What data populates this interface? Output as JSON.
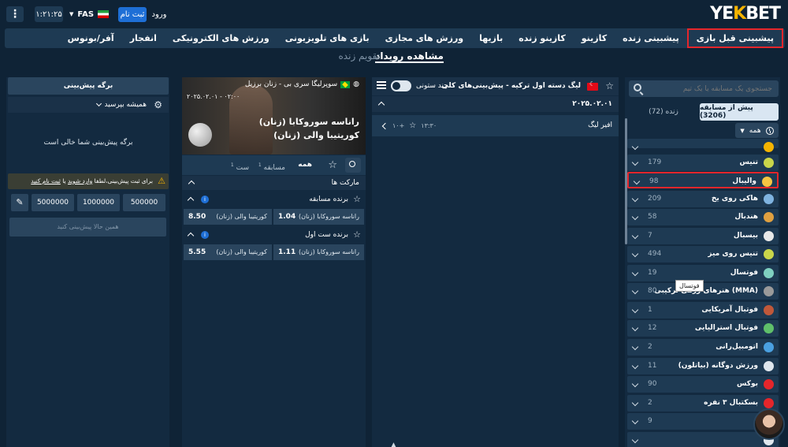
{
  "header": {
    "logo_prefix": "YE",
    "logo_k": "K",
    "logo_suffix": "BET",
    "login": "ورود",
    "register": "ثبت نام",
    "language": "FAS",
    "clock": "۱:۲۱:۲۵",
    "menu_icon": "⋮"
  },
  "nav": [
    "پیشبینی قبل بازی",
    "پیشبینی زنده",
    "کازینو",
    "کازینو زنده",
    "بازیها",
    "ورزش های مجازی",
    "بازی های تلویزیونی",
    "ورزش های الکترونیکی",
    "انفجار",
    "آفر/بونوس"
  ],
  "subnav": {
    "events": "مشاهده رویداد",
    "calendar": "تقویم زنده"
  },
  "sports_panel": {
    "search_placeholder": "جستجوی یک مسابقه یا یک تیم",
    "tab_live": "زنده (72)",
    "tab_prematch": "پیش از مسابقه (3206)",
    "filter": "همه",
    "tooltip": "فوتسال",
    "sports": [
      {
        "name": "",
        "count": "",
        "color": "#f5b400",
        "icon": "soccer-icon"
      },
      {
        "name": "تنیس",
        "count": "179",
        "color": "#c9d64a",
        "icon": "tennis-icon"
      },
      {
        "name": "والیبال",
        "count": "98",
        "color": "#f5c542",
        "icon": "volleyball-icon"
      },
      {
        "name": "هاکی روی یخ",
        "count": "209",
        "color": "#7fb3e0",
        "icon": "ice-hockey-icon"
      },
      {
        "name": "هندبال",
        "count": "58",
        "color": "#e0a040",
        "icon": "handball-icon"
      },
      {
        "name": "بیسبال",
        "count": "7",
        "color": "#e8e8e8",
        "icon": "baseball-icon"
      },
      {
        "name": "تنیس روی میز",
        "count": "494",
        "color": "#c9d64a",
        "icon": "table-tennis-icon"
      },
      {
        "name": "فوتسال",
        "count": "19",
        "color": "#7fd0c0",
        "icon": "futsal-icon"
      },
      {
        "name": "هنرهای رزمی ترکیبی (MMA)",
        "count": "80",
        "color": "#9a9a9a",
        "icon": "mma-icon"
      },
      {
        "name": "فوتبال آمریکایی",
        "count": "1",
        "color": "#c0583a",
        "icon": "american-football-icon"
      },
      {
        "name": "فوتبال استرالیایی",
        "count": "12",
        "color": "#5fbf6a",
        "icon": "aussie-rules-icon"
      },
      {
        "name": "اتومبیل‌رانی",
        "count": "2",
        "color": "#4aa0e0",
        "icon": "motorsport-icon"
      },
      {
        "name": "ورزش دوگانه (بیاتلون)",
        "count": "11",
        "color": "#dfe7ee",
        "icon": "biathlon-icon"
      },
      {
        "name": "بوکس",
        "count": "90",
        "color": "#e5262b",
        "icon": "boxing-icon"
      },
      {
        "name": "بسکتبال ۳ نفره",
        "count": "2",
        "color": "#e5262b",
        "icon": "3x3-icon"
      },
      {
        "name": "",
        "count": "9",
        "color": "#dfe7ee",
        "icon": "sport-icon"
      },
      {
        "name": "",
        "count": "",
        "color": "#dfe7ee",
        "icon": "sport-icon"
      }
    ]
  },
  "center": {
    "league": "لیگ دسته اول ترکیه - پیش‌بینی‌های کلی",
    "multi_column": "چند ستونی",
    "date": "۲۰۲۵.۰۲.۰۱",
    "match": "افیر لیگ",
    "match_time": "۱۳:۳۰",
    "match_count": "۱۰+"
  },
  "event": {
    "league": "سوپرلیگا سری بی - زنان برزیل",
    "date": "۲۰۲۵.۰۲.۰۱ - ۰۲:۰۰",
    "team1": "راناسه سوروکابا (زنان)",
    "team2": "کوریتیبا والی (زنان)",
    "tab_all": "همه",
    "tab_match": "مسابقه",
    "tab_match_count": "1",
    "tab_set": "ست",
    "tab_set_count": "1",
    "markets_title": "مارکت ها",
    "markets": [
      {
        "title": "برنده مسابقه",
        "odds": [
          {
            "name": "راناسه سوروکابا (زنان)",
            "value": "1.04"
          },
          {
            "name": "کوریتیبا والی (زنان)",
            "value": "8.50"
          }
        ]
      },
      {
        "title": "برنده ست اول",
        "odds": [
          {
            "name": "راناسه سوروکابا (زنان)",
            "value": "1.11"
          },
          {
            "name": "کوریتیبا والی (زنان)",
            "value": "5.55"
          }
        ]
      }
    ]
  },
  "slip": {
    "title": "برگه پیش‌بینی",
    "always_ask": "همیشه بپرسید",
    "empty": "برگه پیش‌بینی شما خالی است",
    "warn_prefix": "برای ثبت پیش‌بینی،لطفا",
    "warn_login": "وارد شوید",
    "warn_or": "یا",
    "warn_register": "ثبت نام کنید",
    "amounts": [
      "500000",
      "1000000",
      "5000000"
    ],
    "place": "همین حالا پیش‌بینی کنید"
  }
}
